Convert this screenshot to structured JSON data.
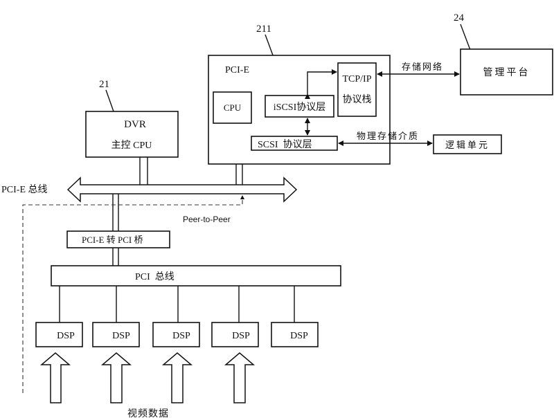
{
  "diagram": {
    "reference_labels": {
      "dvr": "21",
      "pcie_card": "211",
      "management": "24"
    },
    "dvr_box": {
      "line1": "DVR",
      "line2": "主控 CPU"
    },
    "pcie_card": {
      "title": "PCI-E",
      "cpu": "CPU",
      "iscsi_layer": "iSCSI协议层",
      "tcpip_stack_line1": "TCP/IP",
      "tcpip_stack_line2": "协议栈",
      "scsi_layer": "SCSI  协议层"
    },
    "storage_network_label": "存储网络",
    "management_platform": "管理平台",
    "physical_storage_label": "物理存储介质",
    "logical_unit": "逻辑单元",
    "pcie_bus_label": "PCI-E 总线",
    "peer_to_peer_label": "Peer-to-Peer",
    "bridge_label": "PCI-E 转 PCI 桥",
    "pci_bus_label": "PCI  总线",
    "dsp_boxes": [
      "DSP",
      "DSP",
      "DSP",
      "DSP",
      "DSP"
    ],
    "video_data_label": "视频数据"
  }
}
